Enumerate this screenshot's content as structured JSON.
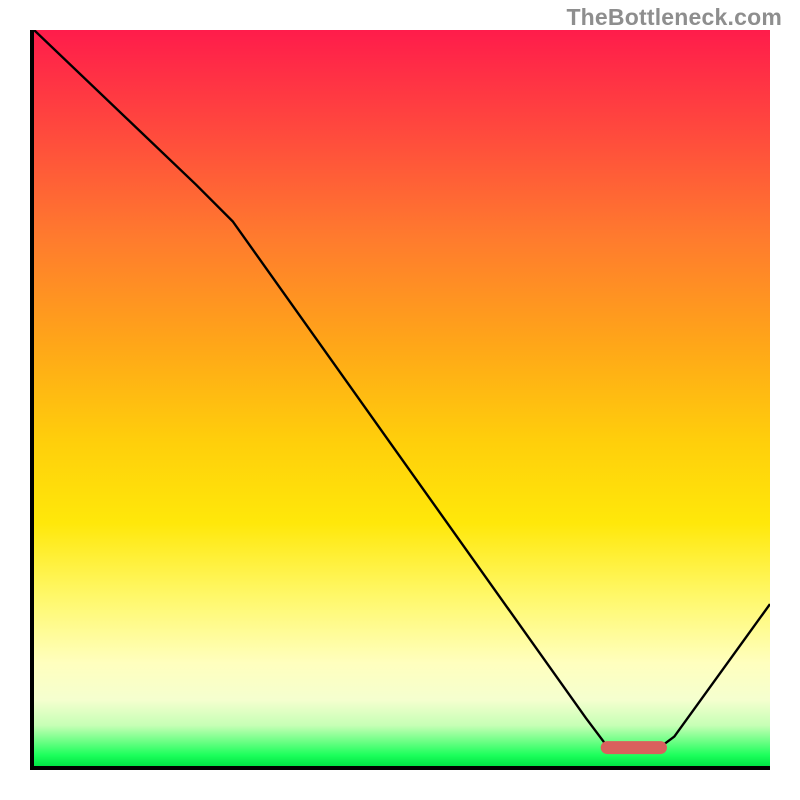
{
  "attribution": "TheBottleneck.com",
  "chart_data": {
    "type": "line",
    "title": "",
    "xlabel": "",
    "ylabel": "",
    "xlim": [
      0,
      100
    ],
    "ylim": [
      0,
      100
    ],
    "series": [
      {
        "name": "bottleneck-curve",
        "x": [
          0,
          22,
          27,
          75,
          78,
          85,
          87,
          100
        ],
        "values": [
          100,
          79,
          74,
          6.5,
          2.5,
          2.5,
          4,
          22
        ]
      }
    ],
    "annotations": [
      {
        "name": "optimal-flat-segment",
        "x_start": 77,
        "x_end": 86,
        "y": 2.5,
        "color": "#d9605d"
      }
    ],
    "background_gradient_stops": [
      {
        "pos": 0.0,
        "color": "#ff1c4b"
      },
      {
        "pos": 0.14,
        "color": "#ff4a3d"
      },
      {
        "pos": 0.28,
        "color": "#ff7a2e"
      },
      {
        "pos": 0.43,
        "color": "#ffa718"
      },
      {
        "pos": 0.56,
        "color": "#ffcf0b"
      },
      {
        "pos": 0.67,
        "color": "#ffe80a"
      },
      {
        "pos": 0.77,
        "color": "#fff86a"
      },
      {
        "pos": 0.86,
        "color": "#ffffbe"
      },
      {
        "pos": 0.91,
        "color": "#f5ffcf"
      },
      {
        "pos": 0.945,
        "color": "#c6ffb5"
      },
      {
        "pos": 0.97,
        "color": "#5eff7e"
      },
      {
        "pos": 0.985,
        "color": "#1dff5c"
      },
      {
        "pos": 1.0,
        "color": "#00e544"
      }
    ]
  }
}
